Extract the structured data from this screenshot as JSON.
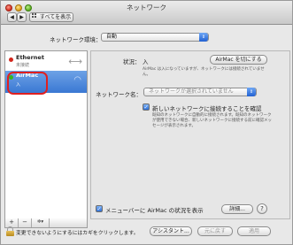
{
  "window": {
    "title": "ネットワーク"
  },
  "toolbar": {
    "back": "◀",
    "forward": "▶",
    "show_all": "すべてを表示"
  },
  "environment": {
    "label": "ネットワーク環境：",
    "value": "自動",
    "arrow": "⇕"
  },
  "sidebar": {
    "items": [
      {
        "name": "Ethernet",
        "status": "未接続",
        "status_color": "#d3261c",
        "icon": "ethernet-arrows-icon"
      },
      {
        "name": "AirMac",
        "status": "入",
        "status_color": "#36b520",
        "icon": "wifi-icon",
        "selected": true
      }
    ],
    "buttons": {
      "add": "+",
      "remove": "−",
      "action": "✲▾"
    }
  },
  "detail": {
    "status_label": "状況：",
    "status_value": "入",
    "toggle_button": "AirMac を切にする",
    "status_desc": "AirMac は入になっていますが、ネットワークには接続されていません。",
    "netname_label": "ネットワーク名：",
    "netname_placeholder": "ネットワークが選択されていません",
    "netname_arrow": "⇕",
    "ask_checked": true,
    "ask_label": "新しいネットワークに接続することを確認",
    "ask_desc": "既知のネットワークに自動的に接続されます。既知のネットワークが使用できない場合、新しいネットワークに接続する前に確認メッセージが表示されます。",
    "menubar_checked": true,
    "menubar_label": "メニューバーに AirMac の状況を表示",
    "detail_button": "詳細...",
    "help_button": "?"
  },
  "footer": {
    "lock_text": "変更できないようにするにはカギをクリックします。",
    "assistant_button": "アシスタント...",
    "revert_button": "元に戻す",
    "apply_button": "適用"
  },
  "colors": {
    "selection": "#3a78d3",
    "accent": "#2d6fd7"
  }
}
